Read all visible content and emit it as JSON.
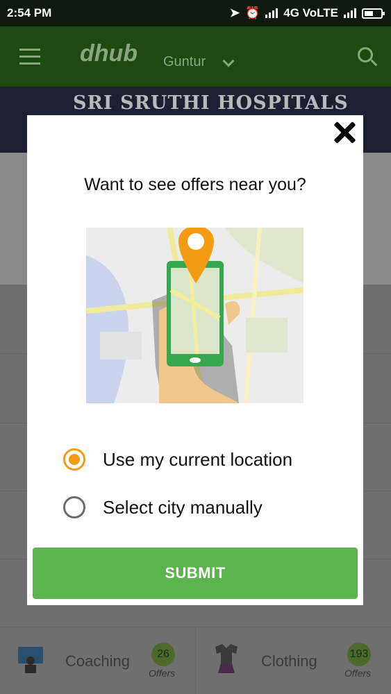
{
  "status_bar": {
    "time": "2:54 PM",
    "network": "4G VoLTE"
  },
  "app_bar": {
    "logo": "dhub",
    "city": "Guntur"
  },
  "banner": {
    "title": "SRI SRUTHI HOSPITALS"
  },
  "categories_bottom": [
    {
      "name": "Coaching",
      "offers_count": "26",
      "offers_label": "Offers"
    },
    {
      "name": "Clothing",
      "offers_count": "193",
      "offers_label": "Offers"
    }
  ],
  "modal": {
    "question": "Want to see offers near you?",
    "options": [
      {
        "label": "Use my current location",
        "selected": true
      },
      {
        "label": "Select city manually",
        "selected": false
      }
    ],
    "submit_label": "SUBMIT"
  },
  "colors": {
    "accent_orange": "#f39b13",
    "submit_green": "#5bb44e",
    "appbar_green": "#2f8b1e"
  }
}
